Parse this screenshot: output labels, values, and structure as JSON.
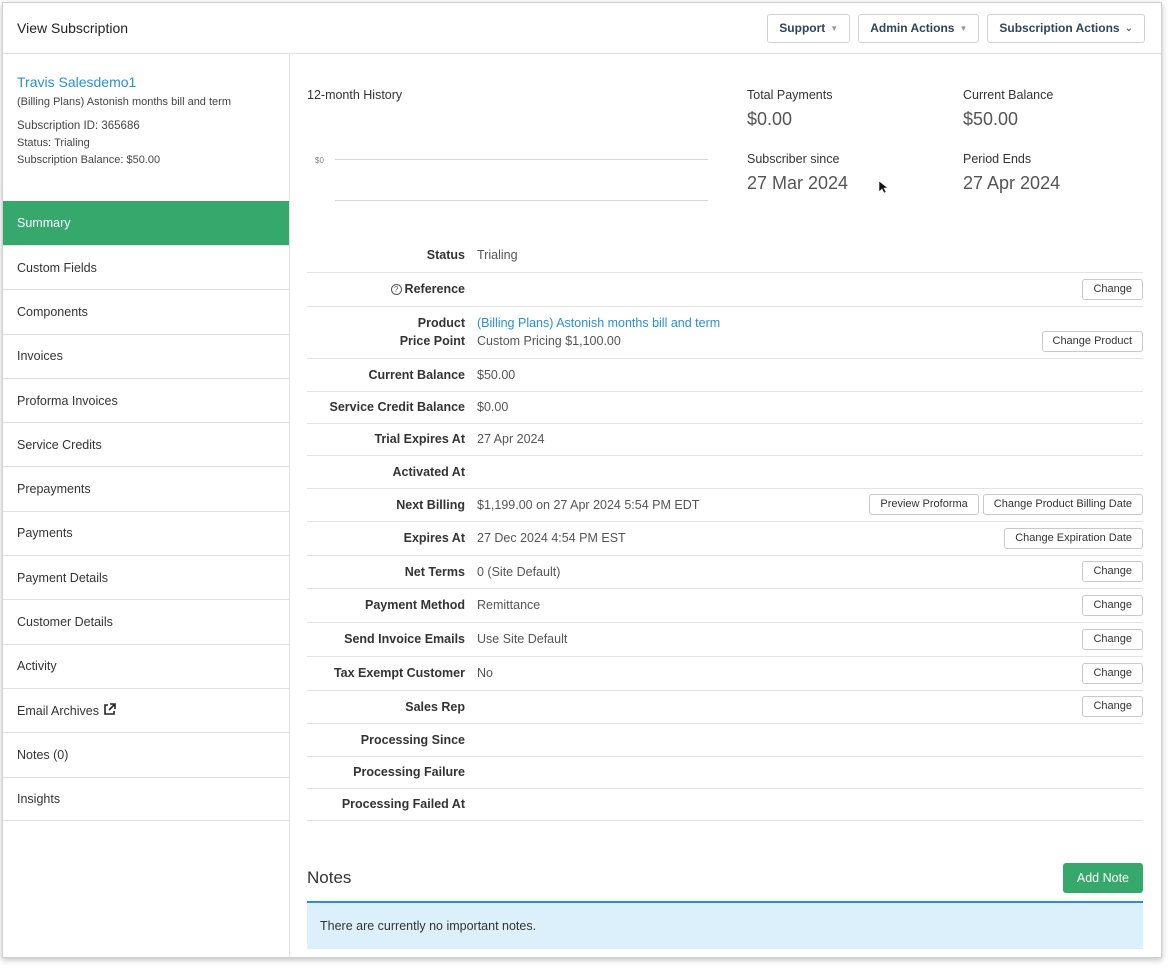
{
  "header": {
    "title": "View Subscription",
    "support_label": "Support",
    "admin_label": "Admin Actions",
    "subscription_label": "Subscription Actions"
  },
  "customer": {
    "name": "Travis Salesdemo1",
    "plan": "(Billing Plans) Astonish months bill and term",
    "subscription_id": "Subscription ID: 365686",
    "status": "Status: Trialing",
    "balance": "Subscription Balance: $50.00"
  },
  "nav": {
    "items": [
      {
        "label": "Summary",
        "active": true
      },
      {
        "label": "Custom Fields"
      },
      {
        "label": "Components"
      },
      {
        "label": "Invoices"
      },
      {
        "label": "Proforma Invoices"
      },
      {
        "label": "Service Credits"
      },
      {
        "label": "Prepayments"
      },
      {
        "label": "Payments"
      },
      {
        "label": "Payment Details"
      },
      {
        "label": "Customer Details"
      },
      {
        "label": "Activity"
      },
      {
        "label": "Email Archives"
      },
      {
        "label": "Notes (0)"
      },
      {
        "label": "Insights"
      }
    ]
  },
  "history": {
    "title": "12-month History",
    "zero_label": "$0"
  },
  "stats": {
    "total_payments_label": "Total Payments",
    "total_payments_value": "$0.00",
    "current_balance_label": "Current Balance",
    "current_balance_value": "$50.00",
    "subscriber_since_label": "Subscriber since",
    "subscriber_since_value": "27 Mar 2024",
    "period_ends_label": "Period Ends",
    "period_ends_value": "27 Apr 2024"
  },
  "details": {
    "status": {
      "label": "Status",
      "value": "Trialing"
    },
    "reference": {
      "label": "Reference",
      "button": "Change"
    },
    "product": {
      "label": "Product",
      "value": "(Billing Plans) Astonish months bill and term"
    },
    "price_point": {
      "label": "Price Point",
      "value": "Custom Pricing $1,100.00",
      "button": "Change Product"
    },
    "current_balance": {
      "label": "Current Balance",
      "value": "$50.00"
    },
    "service_credit": {
      "label": "Service Credit Balance",
      "value": "$0.00"
    },
    "trial_expires": {
      "label": "Trial Expires At",
      "value": "27 Apr 2024"
    },
    "activated": {
      "label": "Activated At",
      "value": ""
    },
    "next_billing": {
      "label": "Next Billing",
      "value": "$1,199.00 on 27 Apr 2024 5:54 PM EDT",
      "button1": "Preview Proforma",
      "button2": "Change Product Billing Date"
    },
    "expires": {
      "label": "Expires At",
      "value": "27 Dec 2024 4:54 PM EST",
      "button": "Change Expiration Date"
    },
    "net_terms": {
      "label": "Net Terms",
      "value": "0 (Site Default)",
      "button": "Change"
    },
    "payment_method": {
      "label": "Payment Method",
      "value": "Remittance",
      "button": "Change"
    },
    "send_invoice": {
      "label": "Send Invoice Emails",
      "value": "Use Site Default",
      "button": "Change"
    },
    "tax_exempt": {
      "label": "Tax Exempt Customer",
      "value": "No",
      "button": "Change"
    },
    "sales_rep": {
      "label": "Sales Rep",
      "value": "",
      "button": "Change"
    },
    "processing_since": {
      "label": "Processing Since",
      "value": ""
    },
    "processing_failure": {
      "label": "Processing Failure",
      "value": ""
    },
    "processing_failed_at": {
      "label": "Processing Failed At",
      "value": ""
    }
  },
  "notes": {
    "title": "Notes",
    "add_button": "Add Note",
    "empty_text": "There are currently no important notes."
  },
  "colors": {
    "accent_green": "#36a86b",
    "link_blue": "#2a8fd0",
    "notes_bg": "#dcf0fb"
  }
}
